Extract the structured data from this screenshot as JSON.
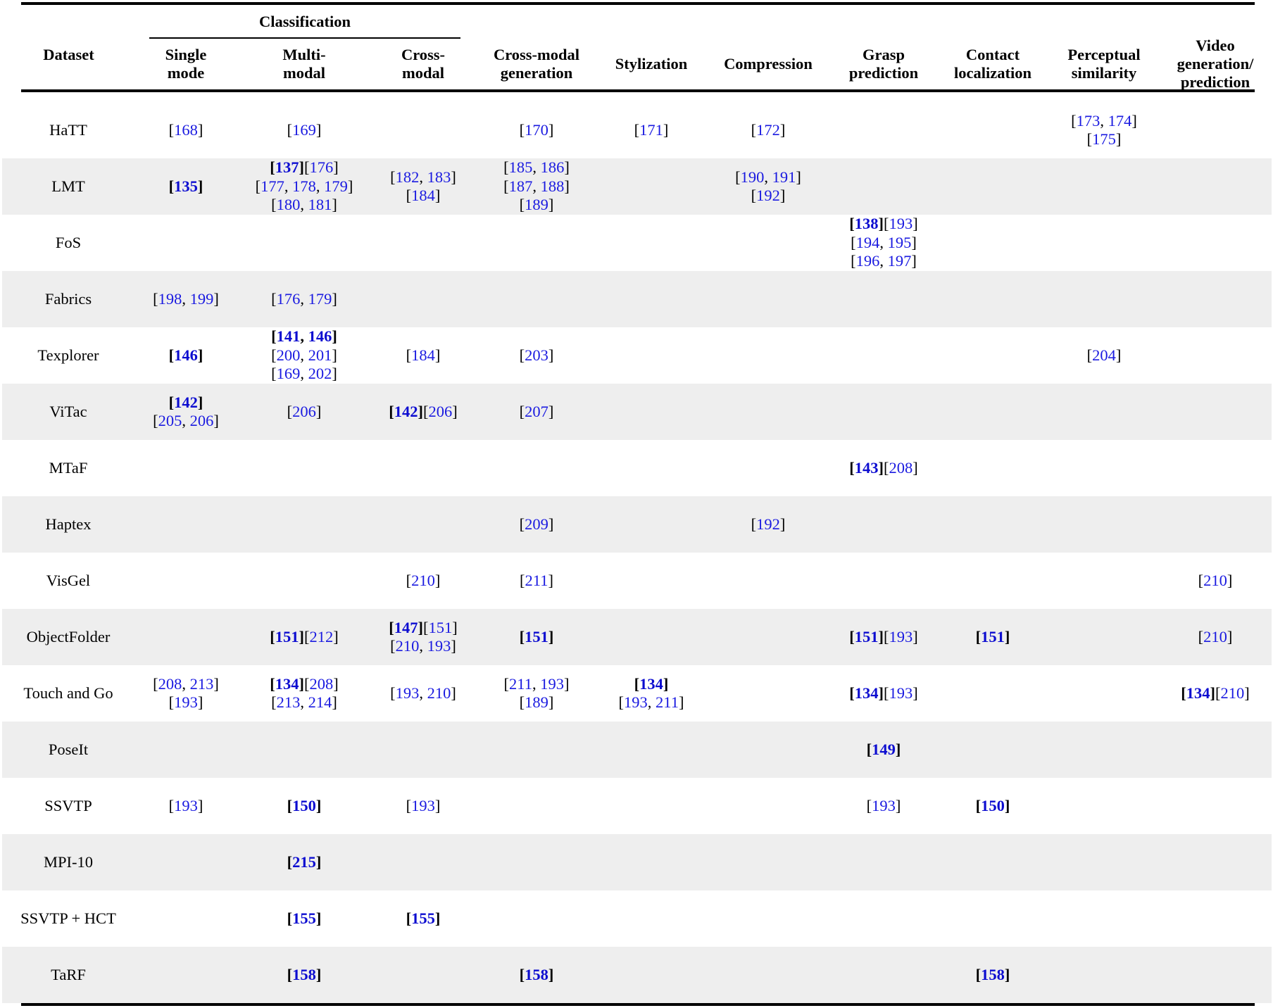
{
  "header": {
    "dataset": "Dataset",
    "classification": "Classification",
    "columns": [
      {
        "key": "single",
        "lines": [
          "Single",
          "mode"
        ]
      },
      {
        "key": "multi",
        "lines": [
          "Multi-",
          "modal"
        ]
      },
      {
        "key": "cross",
        "lines": [
          "Cross-",
          "modal"
        ]
      },
      {
        "key": "xgen",
        "lines": [
          "Cross-modal",
          "generation"
        ]
      },
      {
        "key": "styl",
        "lines": [
          "Stylization"
        ]
      },
      {
        "key": "comp",
        "lines": [
          "Compression"
        ]
      },
      {
        "key": "grasp",
        "lines": [
          "Grasp",
          "prediction"
        ]
      },
      {
        "key": "contact",
        "lines": [
          "Contact",
          "localization"
        ]
      },
      {
        "key": "percep",
        "lines": [
          "Perceptual",
          "similarity"
        ]
      },
      {
        "key": "video",
        "lines": [
          "Video",
          "generation/",
          "prediction"
        ]
      }
    ]
  },
  "rows": [
    {
      "dataset": "HaTT",
      "cells": {
        "single": [
          [
            {
              "t": "168"
            }
          ]
        ],
        "multi": [
          [
            {
              "t": "169"
            }
          ]
        ],
        "xgen": [
          [
            {
              "t": "170"
            }
          ]
        ],
        "styl": [
          [
            {
              "t": "171"
            }
          ]
        ],
        "comp": [
          [
            {
              "t": "172"
            }
          ]
        ],
        "percep": [
          [
            {
              "t": "173"
            },
            {
              "t": "174"
            }
          ],
          [
            {
              "t": "175"
            }
          ]
        ]
      }
    },
    {
      "dataset": "LMT",
      "cells": {
        "single": [
          [
            {
              "t": "135",
              "b": true
            }
          ]
        ],
        "multi": [
          [
            {
              "t": "137",
              "b": true
            }
          ],
          [
            {
              "t": "177"
            },
            {
              "t": "178"
            },
            {
              "t": "179"
            }
          ],
          [
            {
              "t": "180"
            },
            {
              "t": "181"
            }
          ]
        ],
        "cross": [
          [
            {
              "t": "182"
            },
            {
              "t": "183"
            }
          ],
          [
            {
              "t": "184"
            }
          ]
        ],
        "xgen": [
          [
            {
              "t": "185"
            },
            {
              "t": "186"
            }
          ],
          [
            {
              "t": "187"
            },
            {
              "t": "188"
            }
          ],
          [
            {
              "t": "189"
            }
          ]
        ],
        "comp": [
          [
            {
              "t": "190"
            },
            {
              "t": "191"
            }
          ],
          [
            {
              "t": "192"
            }
          ]
        ]
      },
      "extra": {
        "multi": [
          null,
          "176"
        ]
      }
    },
    {
      "dataset": "FoS",
      "cells": {
        "grasp": [
          [
            {
              "t": "138",
              "b": true
            }
          ],
          [
            {
              "t": "194"
            },
            {
              "t": "195"
            }
          ],
          [
            {
              "t": "196"
            },
            {
              "t": "197"
            }
          ]
        ]
      },
      "extra": {
        "grasp": [
          null,
          "193"
        ]
      }
    },
    {
      "dataset": "Fabrics",
      "cells": {
        "single": [
          [
            {
              "t": "198"
            },
            {
              "t": "199"
            }
          ]
        ],
        "multi": [
          [
            {
              "t": "176"
            },
            {
              "t": "179"
            }
          ]
        ]
      }
    },
    {
      "dataset": "Texplorer",
      "cells": {
        "single": [
          [
            {
              "t": "146",
              "b": true
            }
          ]
        ],
        "multi": [
          [
            {
              "t": "141",
              "b": true
            },
            {
              "t": "146",
              "b": true
            }
          ],
          [
            {
              "t": "200"
            },
            {
              "t": "201"
            }
          ],
          [
            {
              "t": "169"
            },
            {
              "t": "202"
            }
          ]
        ],
        "cross": [
          [
            {
              "t": "184"
            }
          ]
        ],
        "xgen": [
          [
            {
              "t": "203"
            }
          ]
        ],
        "percep": [
          [
            {
              "t": "204"
            }
          ]
        ]
      }
    },
    {
      "dataset": "ViTac",
      "cells": {
        "single": [
          [
            {
              "t": "142",
              "b": true
            }
          ],
          [
            {
              "t": "205"
            },
            {
              "t": "206"
            }
          ]
        ],
        "multi": [
          [
            {
              "t": "206"
            }
          ]
        ],
        "cross": [
          [
            {
              "t": "142",
              "b": true
            }
          ]
        ],
        "xgen": [
          [
            {
              "t": "207"
            }
          ]
        ]
      },
      "extra": {
        "cross": [
          null,
          "206"
        ]
      }
    },
    {
      "dataset": "MTaF",
      "cells": {
        "grasp": [
          [
            {
              "t": "143",
              "b": true
            }
          ]
        ]
      },
      "extra": {
        "grasp": [
          null,
          "208"
        ]
      }
    },
    {
      "dataset": "Haptex",
      "cells": {
        "xgen": [
          [
            {
              "t": "209"
            }
          ]
        ],
        "comp": [
          [
            {
              "t": "192"
            }
          ]
        ]
      }
    },
    {
      "dataset": "VisGel",
      "cells": {
        "cross": [
          [
            {
              "t": "210"
            }
          ]
        ],
        "xgen": [
          [
            {
              "t": "211"
            }
          ]
        ],
        "video": [
          [
            {
              "t": "210"
            }
          ]
        ]
      }
    },
    {
      "dataset": "ObjectFolder",
      "cells": {
        "multi": [
          [
            {
              "t": "151",
              "b": true
            }
          ]
        ],
        "cross": [
          [
            {
              "t": "147",
              "b": true
            }
          ],
          [
            {
              "t": "210"
            },
            {
              "t": "193"
            }
          ]
        ],
        "xgen": [
          [
            {
              "t": "151",
              "b": true
            }
          ]
        ],
        "grasp": [
          [
            {
              "t": "151",
              "b": true
            }
          ]
        ],
        "contact": [
          [
            {
              "t": "151",
              "b": true
            }
          ]
        ],
        "video": [
          [
            {
              "t": "210"
            }
          ]
        ]
      },
      "extra": {
        "multi": [
          null,
          "212"
        ],
        "cross": [
          null,
          "151"
        ],
        "grasp": [
          null,
          "193"
        ]
      }
    },
    {
      "dataset": "Touch and Go",
      "cells": {
        "single": [
          [
            {
              "t": "208"
            },
            {
              "t": "213"
            }
          ],
          [
            {
              "t": "193"
            }
          ]
        ],
        "multi": [
          [
            {
              "t": "134",
              "b": true
            }
          ],
          [
            {
              "t": "213"
            },
            {
              "t": "214"
            }
          ]
        ],
        "cross": [
          [
            {
              "t": "193"
            },
            {
              "t": "210"
            }
          ]
        ],
        "xgen": [
          [
            {
              "t": "211"
            },
            {
              "t": "193"
            }
          ],
          [
            {
              "t": "189"
            }
          ]
        ],
        "styl": [
          [
            {
              "t": "134",
              "b": true
            }
          ],
          [
            {
              "t": "193"
            },
            {
              "t": "211"
            }
          ]
        ],
        "grasp": [
          [
            {
              "t": "134",
              "b": true
            }
          ]
        ],
        "video": [
          [
            {
              "t": "134",
              "b": true
            }
          ]
        ]
      },
      "extra": {
        "multi": [
          null,
          "208"
        ],
        "grasp": [
          null,
          "193"
        ],
        "video": [
          null,
          "210"
        ]
      }
    },
    {
      "dataset": "PoseIt",
      "cells": {
        "grasp": [
          [
            {
              "t": "149",
              "b": true
            }
          ]
        ]
      }
    },
    {
      "dataset": "SSVTP",
      "cells": {
        "single": [
          [
            {
              "t": "193"
            }
          ]
        ],
        "multi": [
          [
            {
              "t": "150",
              "b": true
            }
          ]
        ],
        "cross": [
          [
            {
              "t": "193"
            }
          ]
        ],
        "grasp": [
          [
            {
              "t": "193"
            }
          ]
        ],
        "contact": [
          [
            {
              "t": "150",
              "b": true
            }
          ]
        ]
      }
    },
    {
      "dataset": "MPI-10",
      "cells": {
        "multi": [
          [
            {
              "t": "215",
              "b": true
            }
          ]
        ]
      }
    },
    {
      "dataset": "SSVTP + HCT",
      "cells": {
        "multi": [
          [
            {
              "t": "155",
              "b": true
            }
          ]
        ],
        "cross": [
          [
            {
              "t": "155",
              "b": true
            }
          ]
        ]
      }
    },
    {
      "dataset": "TaRF",
      "cells": {
        "multi": [
          [
            {
              "t": "158",
              "b": true
            }
          ]
        ],
        "xgen": [
          [
            {
              "t": "158",
              "b": true
            }
          ]
        ],
        "contact": [
          [
            {
              "t": "158",
              "b": true
            }
          ]
        ]
      }
    }
  ]
}
